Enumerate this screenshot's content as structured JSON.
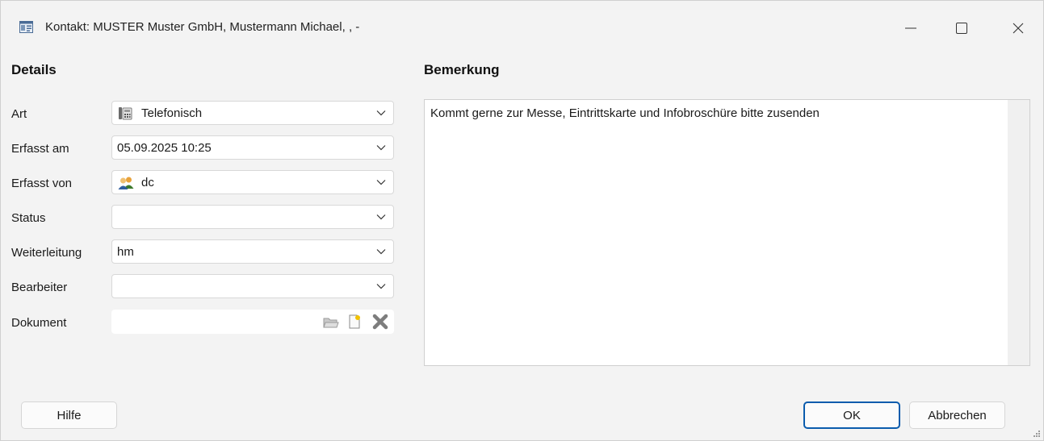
{
  "window": {
    "title": "Kontakt: MUSTER Muster GmbH, Mustermann Michael, , -",
    "icon": "contact-card-icon",
    "controls": [
      "minimize-icon",
      "maximize-icon",
      "close-icon"
    ]
  },
  "details": {
    "heading": "Details",
    "fields": {
      "art": {
        "label": "Art",
        "value": "Telefonisch",
        "icon": "telephone-icon"
      },
      "erfasst_am": {
        "label": "Erfasst am",
        "value": "05.09.2025 10:25"
      },
      "erfasst_von": {
        "label": "Erfasst von",
        "value": "dc",
        "icon": "users-icon"
      },
      "status": {
        "label": "Status",
        "value": ""
      },
      "weiterleitung": {
        "label": "Weiterleitung",
        "value": "hm"
      },
      "bearbeiter": {
        "label": "Bearbeiter",
        "value": ""
      },
      "dokument": {
        "label": "Dokument",
        "value": "",
        "actions": [
          "open-folder-icon",
          "new-document-icon",
          "delete-icon"
        ]
      }
    }
  },
  "remark": {
    "heading": "Bemerkung",
    "text": "Kommt gerne zur Messe, Eintrittskarte und Infobroschüre bitte zusenden"
  },
  "buttons": {
    "help": "Hilfe",
    "ok": "OK",
    "cancel": "Abbrechen"
  }
}
